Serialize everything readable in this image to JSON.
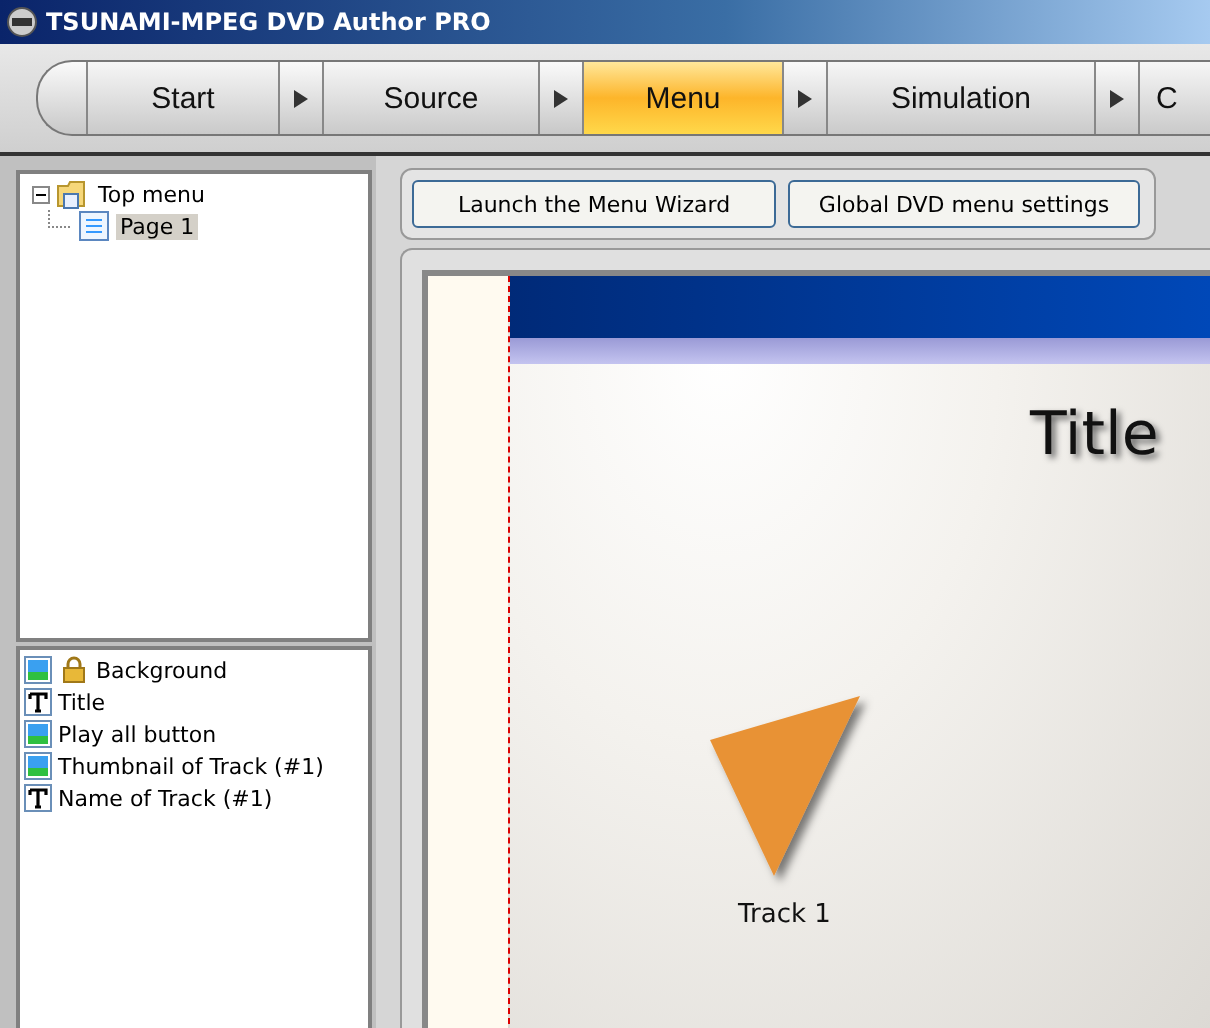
{
  "window": {
    "title": "TSUNAMI-MPEG DVD Author PRO"
  },
  "steps": [
    {
      "label": "Start",
      "selected": false
    },
    {
      "label": "Source",
      "selected": false
    },
    {
      "label": "Menu",
      "selected": true
    },
    {
      "label": "Simulation",
      "selected": false
    },
    {
      "label": "C",
      "selected": false
    }
  ],
  "menu_tree": [
    {
      "label": "Top menu",
      "expanded": true,
      "selected": false,
      "children": [
        {
          "label": "Page 1",
          "selected": true
        }
      ]
    }
  ],
  "layers": [
    {
      "kind": "image",
      "label": "Background",
      "locked": true
    },
    {
      "kind": "text",
      "label": "Title",
      "locked": false
    },
    {
      "kind": "image",
      "label": "Play all button",
      "locked": false
    },
    {
      "kind": "image",
      "label": "Thumbnail of Track (#1)",
      "locked": false
    },
    {
      "kind": "text",
      "label": "Name of Track (#1)",
      "locked": false
    }
  ],
  "toolbar": {
    "buttons": [
      "Launch the Menu Wizard",
      "Global DVD menu settings"
    ]
  },
  "preview": {
    "title": "Title",
    "track_label": "Track 1"
  }
}
